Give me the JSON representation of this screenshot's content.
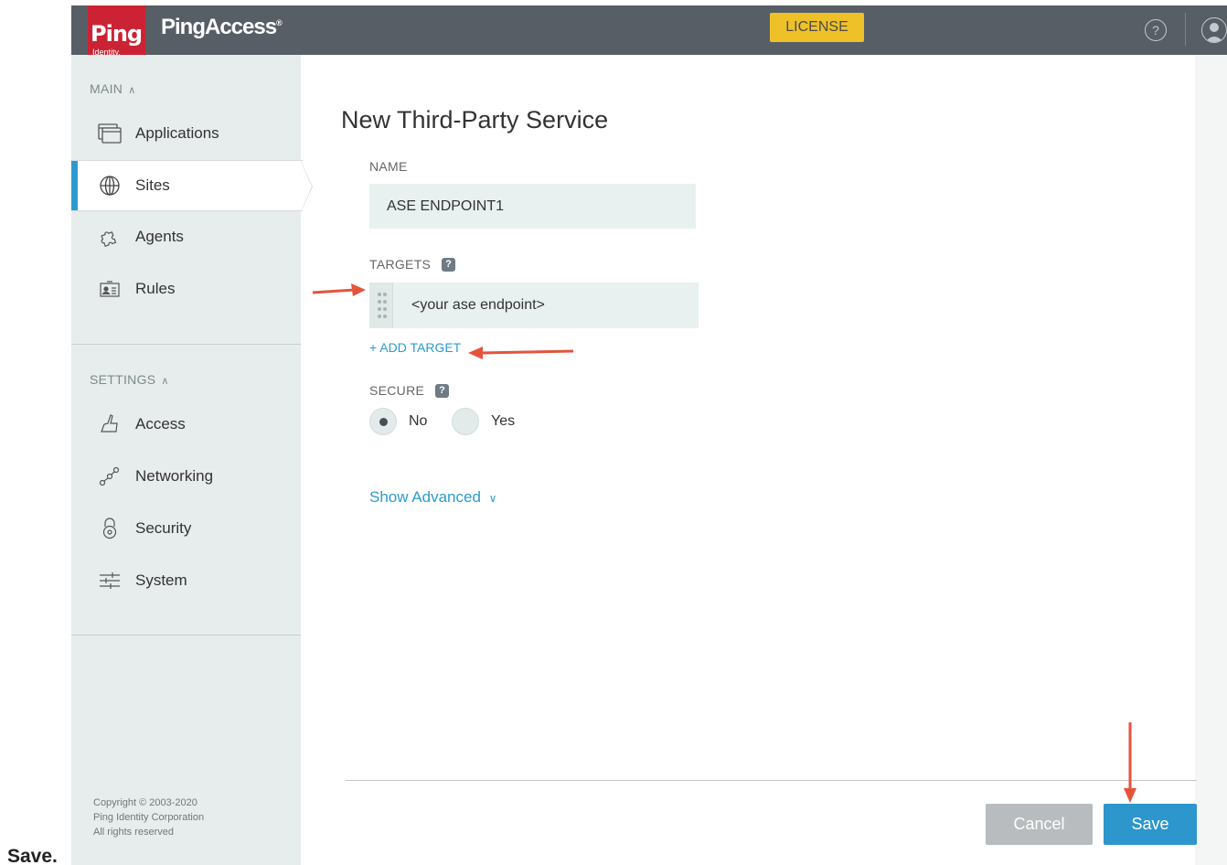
{
  "app": {
    "logo_text": "Ping",
    "logo_sub": "Identity.",
    "product_name": "PingAccess",
    "product_mark": "®",
    "license_label": "LICENSE",
    "help_label": "?"
  },
  "sidebar": {
    "main_label": "MAIN",
    "settings_label": "SETTINGS",
    "main_items": [
      {
        "label": "Applications",
        "icon": "applications-icon"
      },
      {
        "label": "Sites",
        "icon": "globe-icon",
        "active": true
      },
      {
        "label": "Agents",
        "icon": "puzzle-icon"
      },
      {
        "label": "Rules",
        "icon": "id-card-icon"
      }
    ],
    "settings_items": [
      {
        "label": "Access",
        "icon": "hand-icon"
      },
      {
        "label": "Networking",
        "icon": "network-icon"
      },
      {
        "label": "Security",
        "icon": "lock-icon"
      },
      {
        "label": "System",
        "icon": "sliders-icon"
      }
    ],
    "copyright": [
      "Copyright © 2003-2020",
      "Ping Identity Corporation",
      "All rights reserved"
    ]
  },
  "form": {
    "title": "New Third-Party Service",
    "name_label": "NAME",
    "name_value": "ASE ENDPOINT1",
    "targets_label": "TARGETS",
    "target_value": "<your ase endpoint>",
    "add_target": "+ ADD TARGET",
    "secure_label": "SECURE",
    "secure_options": [
      "No",
      "Yes"
    ],
    "secure_selected": "No",
    "show_advanced": "Show Advanced",
    "cancel_label": "Cancel",
    "save_label": "Save"
  },
  "caption": "Save.",
  "colors": {
    "topbar": "#575e66",
    "brand_red": "#cb2333",
    "license": "#efc129",
    "accent": "#2b9bcf",
    "save": "#2d96cd",
    "annotation_arrow": "#e5533d"
  }
}
